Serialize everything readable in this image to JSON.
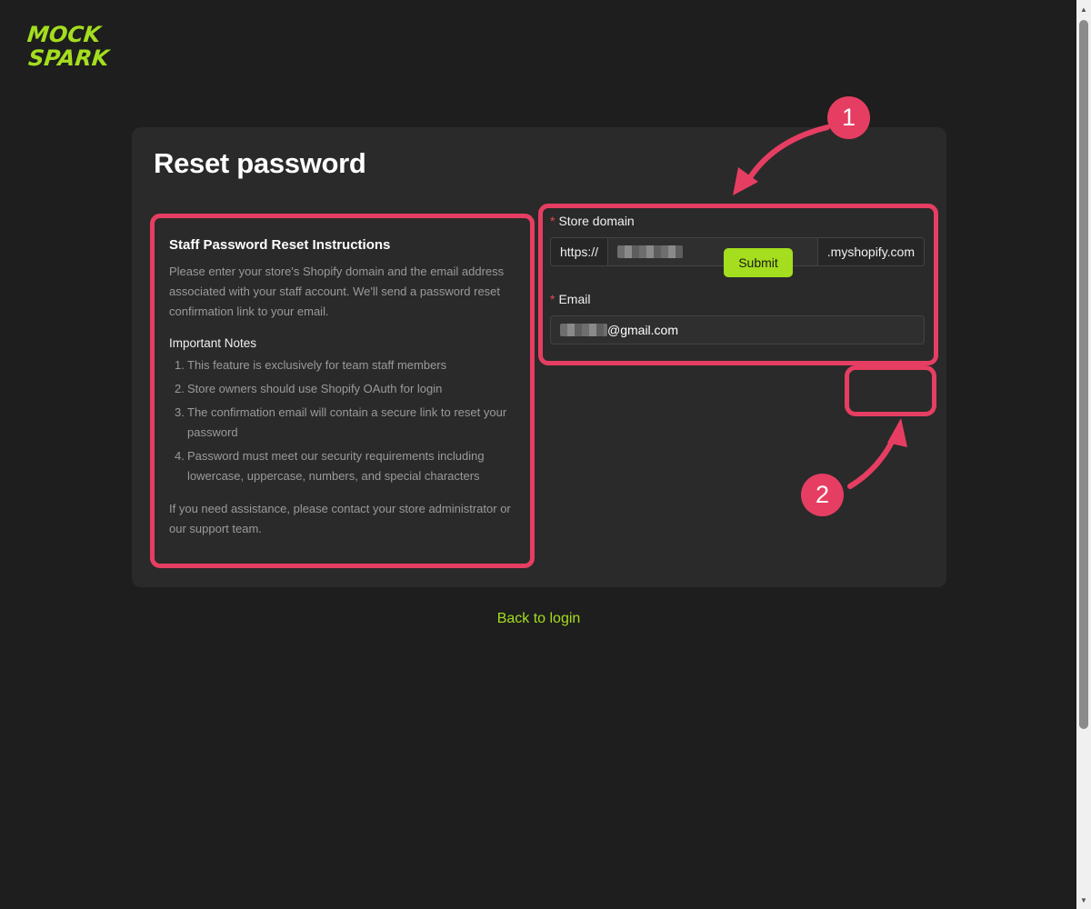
{
  "logo": {
    "line1": "MOCK",
    "line2": "SPARK",
    "color": "#a4de1e"
  },
  "page": {
    "title": "Reset password"
  },
  "instructions": {
    "title": "Staff Password Reset Instructions",
    "intro": "Please enter your store's Shopify domain and the email address associated with your staff account. We'll send a password reset confirmation link to your email.",
    "notes_title": "Important Notes",
    "notes": [
      {
        "num": "1.",
        "text": "This feature is exclusively for team staff members"
      },
      {
        "num": "2.",
        "text": "Store owners should use Shopify OAuth for login"
      },
      {
        "num": "3.",
        "text": "The confirmation email will contain a secure link to reset your password"
      },
      {
        "num": "4.",
        "text": "Password must meet our security requirements including lowercase, uppercase, numbers, and special characters"
      }
    ],
    "assistance": "If you need assistance, please contact your store administrator or our support team."
  },
  "form": {
    "store_domain": {
      "label": "Store domain",
      "required_mark": "*",
      "prefix": "https://",
      "suffix": ".myshopify.com"
    },
    "email": {
      "label": "Email",
      "required_mark": "*",
      "visible_value": "@gmail.com"
    },
    "submit_label": "Submit"
  },
  "annotations": {
    "step1": "1",
    "step2": "2",
    "color": "#e63e62"
  },
  "back_link": "Back to login",
  "colors": {
    "accent": "#a4de1e",
    "background": "#1e1e1e",
    "card": "#2a2a2a",
    "annotation": "#e63e62"
  }
}
